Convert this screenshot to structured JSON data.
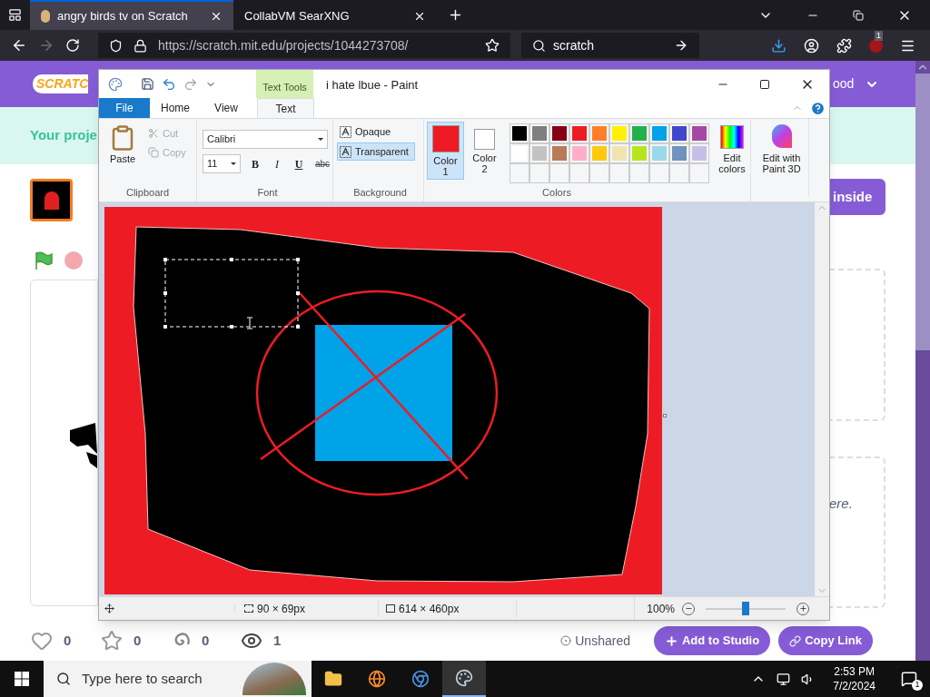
{
  "browser": {
    "tabs": [
      {
        "title": "angry birds tv on Scratch",
        "selected": true
      },
      {
        "title": "CollabVM SearXNG",
        "selected": false
      }
    ],
    "url": "https://scratch.mit.edu/projects/1044273708/",
    "search": "scratch",
    "extension_badge": "1"
  },
  "scratch": {
    "logo": "SCRATC",
    "user_menu": "ood",
    "banner": "Your proje",
    "see_inside": "inside",
    "notes_text": "ere.",
    "stats": [
      {
        "kind": "love",
        "count": "0"
      },
      {
        "kind": "favorite",
        "count": "0"
      },
      {
        "kind": "remix",
        "count": "0"
      },
      {
        "kind": "view",
        "count": "1"
      }
    ],
    "share_status": "Unshared",
    "add_to_studio": "Add to Studio",
    "copy_link": "Copy Link"
  },
  "paint": {
    "title": "i hate lbue - Paint",
    "context_tab": "Text Tools",
    "tabs": [
      {
        "label": "File",
        "kind": "file",
        "selected": false
      },
      {
        "label": "Home",
        "kind": "tab",
        "selected": false
      },
      {
        "label": "View",
        "kind": "tab",
        "selected": false
      },
      {
        "label": "Text",
        "kind": "tab",
        "selected": true
      }
    ],
    "clipboard": {
      "label": "Clipboard",
      "paste": "Paste",
      "cut": {
        "label": "Cut",
        "disabled": true
      },
      "copy": {
        "label": "Copy",
        "disabled": true
      }
    },
    "font": {
      "label": "Font",
      "family": "Calibri",
      "size": "11",
      "bold": "B",
      "italic": "I",
      "underline": "U",
      "strike": "abc"
    },
    "background": {
      "label": "Background",
      "options": [
        {
          "label": "Opaque",
          "selected": false
        },
        {
          "label": "Transparent",
          "selected": true
        }
      ]
    },
    "colors": {
      "label": "Colors",
      "slots": [
        {
          "label": "Color 1",
          "color": "#ed1c24",
          "selected": true
        },
        {
          "label": "Color 2",
          "color": "#ffffff",
          "selected": false
        }
      ],
      "palette": [
        {
          "color": "#000000"
        },
        {
          "color": "#7f7f7f"
        },
        {
          "color": "#880015"
        },
        {
          "color": "#ed1c24"
        },
        {
          "color": "#ff7f27"
        },
        {
          "color": "#fff200"
        },
        {
          "color": "#22b14c"
        },
        {
          "color": "#00a2e8"
        },
        {
          "color": "#3f48cc"
        },
        {
          "color": "#a349a4"
        },
        {
          "color": "#ffffff"
        },
        {
          "color": "#c3c3c3"
        },
        {
          "color": "#b97a57"
        },
        {
          "color": "#ffaec9"
        },
        {
          "color": "#ffc90e"
        },
        {
          "color": "#efe4b0"
        },
        {
          "color": "#b5e61d"
        },
        {
          "color": "#99d9ea"
        },
        {
          "color": "#7092be"
        },
        {
          "color": "#c8bfe7"
        }
      ],
      "edit_colors": "Edit colors"
    },
    "paint3d": "Edit with Paint 3D",
    "status": {
      "selection": "90 × 69px",
      "image": "614 × 460px",
      "zoom": {
        "reading": "100%",
        "level": 0.5
      }
    }
  },
  "taskbar": {
    "search_placeholder": "Type here to search",
    "time": "2:53 PM",
    "date": "7/2/2024",
    "notifications": "1"
  }
}
